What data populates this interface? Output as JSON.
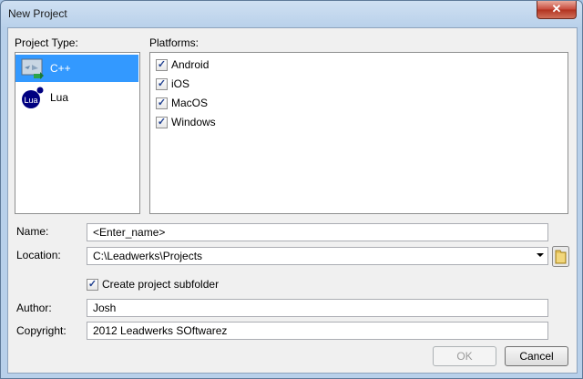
{
  "window": {
    "title": "New Project",
    "close_glyph": "✕"
  },
  "project_type": {
    "label": "Project Type:",
    "items": [
      {
        "label": "C++",
        "icon": "cpp-icon",
        "selected": true
      },
      {
        "label": "Lua",
        "icon": "lua-icon",
        "selected": false
      }
    ]
  },
  "platforms": {
    "label": "Platforms:",
    "items": [
      {
        "label": "Android",
        "checked": true
      },
      {
        "label": "iOS",
        "checked": true
      },
      {
        "label": "MacOS",
        "checked": true
      },
      {
        "label": "Windows",
        "checked": true
      }
    ],
    "check_glyph": "✓"
  },
  "form": {
    "name_label": "Name:",
    "name_value": "<Enter_name>",
    "location_label": "Location:",
    "location_value": "C:\\Leadwerks\\Projects",
    "subfolder_label": "Create project subfolder",
    "subfolder_checked": true,
    "author_label": "Author:",
    "author_value": "Josh",
    "copyright_label": "Copyright:",
    "copyright_value": "2012 Leadwerks SOftwarez"
  },
  "buttons": {
    "ok": "OK",
    "cancel": "Cancel"
  },
  "colors": {
    "selection": "#3399ff",
    "lua_blue": "#000080"
  }
}
